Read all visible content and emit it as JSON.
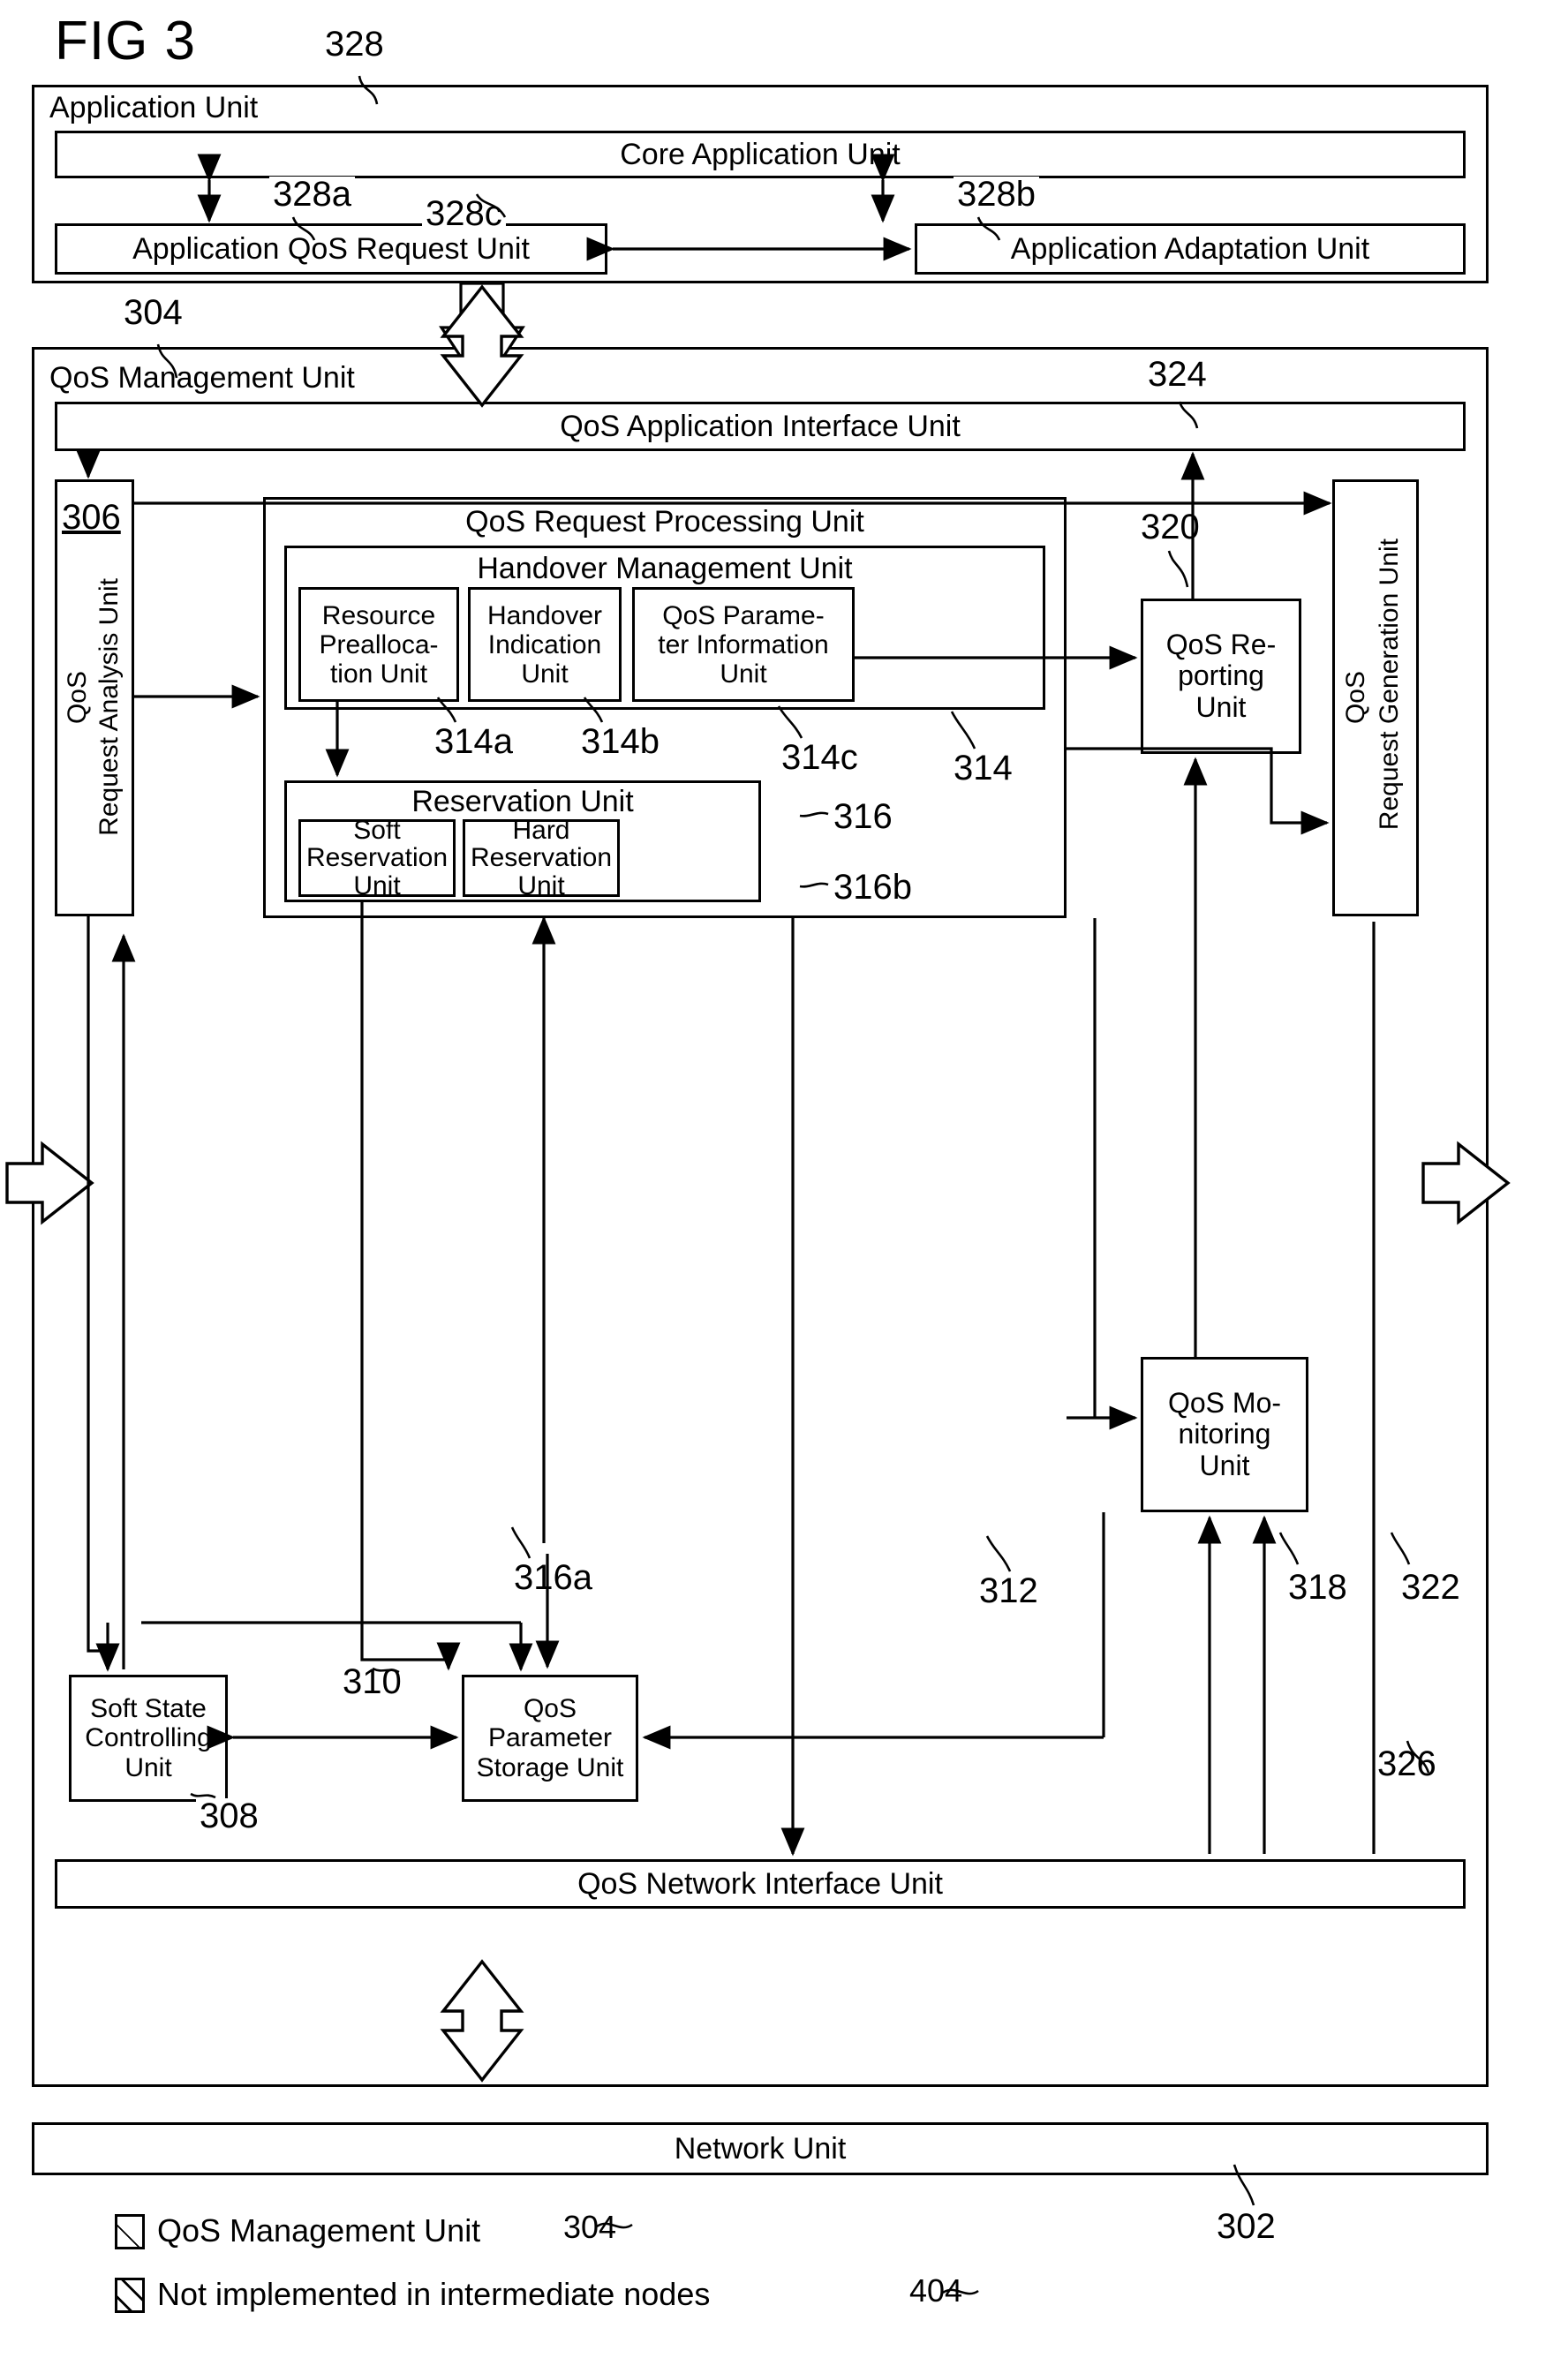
{
  "figure": {
    "label": "FIG 3"
  },
  "application_unit": {
    "ref": "328",
    "title": "Application Unit",
    "core": {
      "label": "Core Application Unit"
    },
    "qos_request": {
      "label": "Application QoS Request Unit",
      "ref": "328a"
    },
    "adaptation": {
      "label": "Application Adaptation Unit",
      "ref": "328b"
    },
    "interlink_ref": "328c"
  },
  "qos_management_unit": {
    "ref": "304",
    "title": "QoS Management Unit",
    "app_interface": {
      "label": "QoS Application Interface Unit",
      "ref": "324"
    },
    "request_analysis": {
      "line1": "QoS",
      "line2": "Request Analysis Unit",
      "ref": "306"
    },
    "request_generation": {
      "line1": "QoS",
      "line2": "Request Generation Unit",
      "ref": "322"
    },
    "request_processing": {
      "label": "QoS Request Processing Unit",
      "ref": "312",
      "handover_management": {
        "label": "Handover Management Unit",
        "ref": "314",
        "children": [
          {
            "label": "Resource Prealloca-­tion Unit",
            "lines": [
              "Resource",
              "Prealloca-",
              "tion Unit"
            ],
            "ref": "314a",
            "hatched": false
          },
          {
            "label": "Handover Indication Unit",
            "lines": [
              "Handover",
              "Indication",
              "Unit"
            ],
            "ref": "314b",
            "hatched": true
          },
          {
            "label": "QoS Parameter Information Unit",
            "lines": [
              "QoS Parame-",
              "ter Information",
              "Unit"
            ],
            "ref": "314c",
            "hatched": true
          }
        ]
      },
      "reservation": {
        "label": "Reservation Unit",
        "ref": "316",
        "children": [
          {
            "lines": [
              "Soft",
              "Reservation",
              "Unit"
            ],
            "ref": "316a"
          },
          {
            "lines": [
              "Hard",
              "Reservation",
              "Unit"
            ],
            "ref": "316b"
          }
        ]
      }
    },
    "reporting": {
      "lines": [
        "QoS Re-",
        "porting",
        "Unit"
      ],
      "ref": "320"
    },
    "monitoring": {
      "lines": [
        "QoS Mo-",
        "nitoring",
        "Unit"
      ],
      "ref": "318"
    },
    "soft_state": {
      "lines": [
        "Soft State",
        "Controlling",
        "Unit"
      ],
      "ref": "308"
    },
    "parameter_storage": {
      "lines": [
        "QoS",
        "Parameter",
        "Storage Unit"
      ],
      "ref": "310"
    },
    "network_interface": {
      "label": "QoS Network Interface Unit",
      "ref": "326"
    }
  },
  "network_unit": {
    "label": "Network Unit",
    "ref": "302"
  },
  "legend": {
    "items": [
      {
        "swatch": "hatch-a",
        "label": "QoS Management Unit",
        "ref": "304"
      },
      {
        "swatch": "hatch-b",
        "label": "Not implemented in intermediate nodes",
        "ref": "404"
      }
    ]
  },
  "colors": {
    "ink": "#000000",
    "paper": "#ffffff"
  }
}
